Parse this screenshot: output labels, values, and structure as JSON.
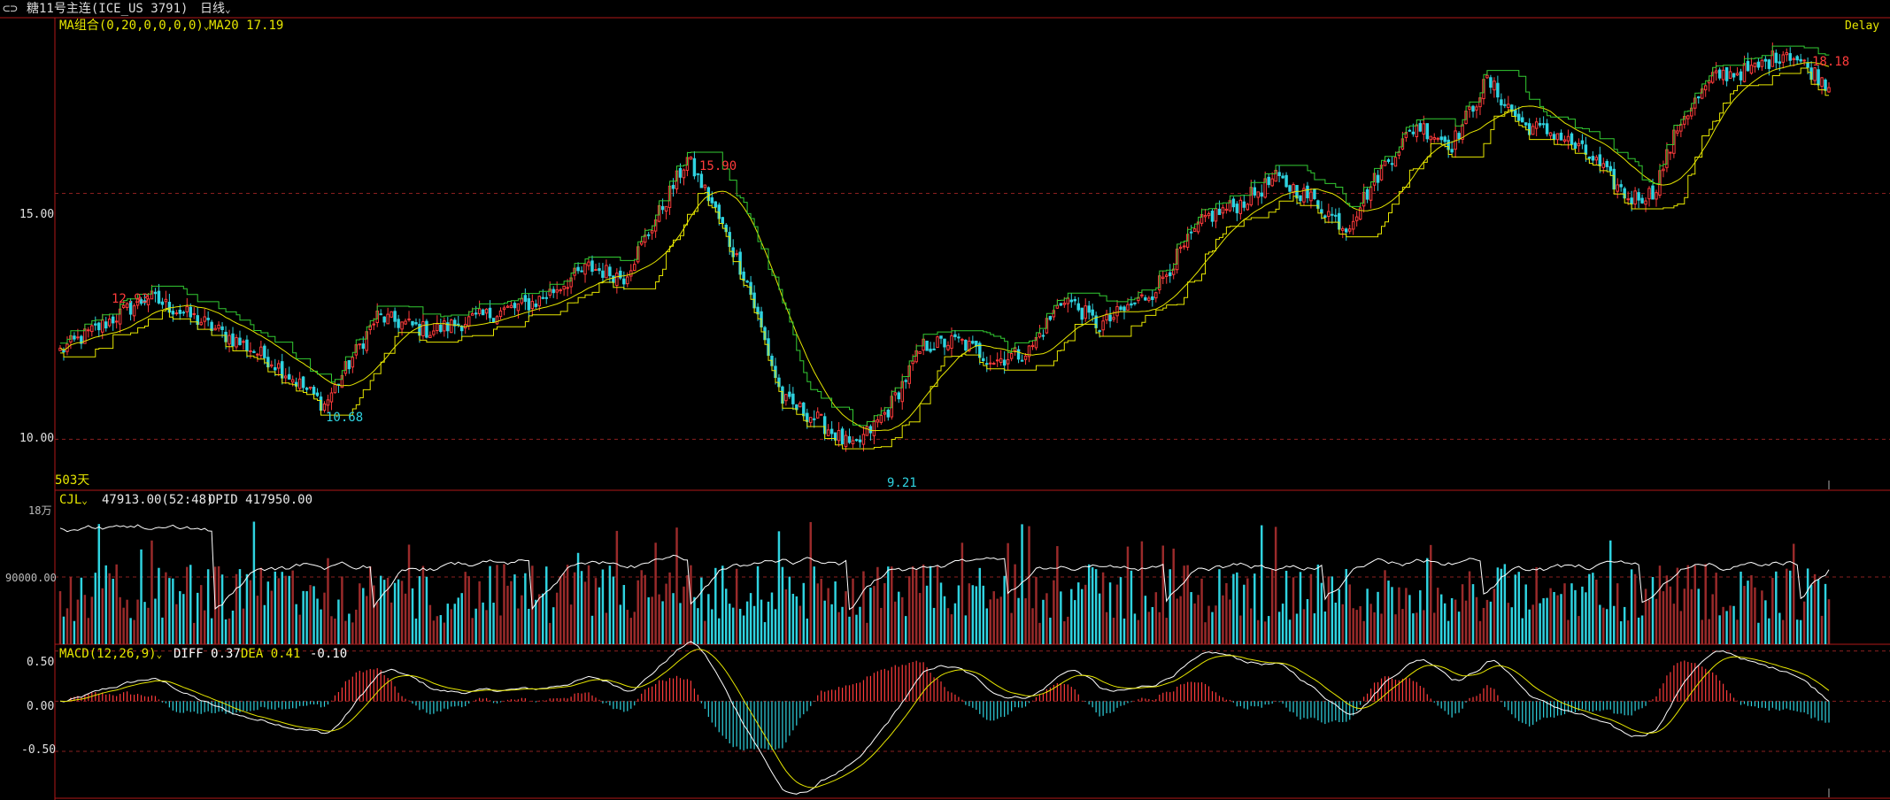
{
  "header": {
    "contract_icon": "link-icon",
    "contract": "糖11号主连(ICE_US 3791)",
    "period": "日线",
    "period_dropdown_icon": "chevron-down-icon"
  },
  "price_panel": {
    "ma_title": "MA组合(0,20,0,0,0,0)",
    "ma_dropdown_icon": "chevron-down-icon",
    "ma20_label": "MA20",
    "ma20_value": "17.19",
    "delay": "Delay",
    "y_ticks": [
      "15.00",
      "10.00"
    ],
    "high_labels": [
      "12.93",
      "15.90",
      "18.18"
    ],
    "low_labels": [
      "10.68",
      "9.21"
    ],
    "days_label": "503天"
  },
  "volume_panel": {
    "title": "CJL",
    "dropdown_icon": "chevron-down-icon",
    "volume_readout": "47913.00(52:48)",
    "opid_readout": "OPID 417950.00",
    "y_ticks": [
      "18万",
      "90000.00"
    ]
  },
  "macd_panel": {
    "title": "MACD(12,26,9)",
    "dropdown_icon": "chevron-down-icon",
    "diff_readout": "DIFF 0.37",
    "dea_readout": "DEA 0.41",
    "macd_readout": "-0.10",
    "y_ticks": [
      "0.50",
      "0.00",
      "-0.50"
    ]
  },
  "colors": {
    "up": "#ff3b3b",
    "down": "#2fd3e0",
    "ma20": "#e6e600",
    "step_green": "#33cc33",
    "step_yellow": "#e6e600",
    "vol_up": "#9a2a2a",
    "vol_down": "#2fd3e0",
    "oi_line": "#ffffff",
    "diff": "#ffffff",
    "dea": "#e6e600",
    "grid": "#8a1f1f",
    "frame": "#b01818"
  },
  "chart_data": {
    "type": "candlestick",
    "bars": 503,
    "ylim": [
      9.0,
      18.5
    ],
    "price_path_anchors": {
      "index": [
        0,
        25,
        40,
        60,
        75,
        90,
        105,
        120,
        135,
        150,
        160,
        170,
        178,
        185,
        195,
        205,
        215,
        225,
        235,
        245,
        255,
        265,
        275,
        285,
        295,
        310,
        325,
        335,
        345,
        355,
        365,
        375,
        385,
        395,
        405,
        415,
        425,
        435,
        445,
        452,
        460,
        470,
        480,
        490,
        502
      ],
      "close": [
        11.8,
        12.9,
        12.4,
        11.6,
        10.7,
        12.5,
        12.2,
        12.5,
        12.8,
        13.5,
        13.3,
        14.6,
        15.7,
        14.8,
        13.2,
        10.8,
        10.4,
        9.8,
        10.6,
        11.9,
        12.0,
        11.6,
        11.8,
        12.9,
        12.3,
        13.0,
        14.5,
        14.8,
        15.3,
        14.9,
        14.3,
        15.5,
        16.4,
        16.0,
        17.3,
        16.4,
        16.2,
        15.7,
        14.9,
        15.0,
        16.5,
        17.4,
        17.5,
        17.9,
        17.2
      ]
    },
    "extremes": [
      {
        "label": "12.93",
        "value": 12.93,
        "kind": "high"
      },
      {
        "label": "10.68",
        "value": 10.68,
        "kind": "low"
      },
      {
        "label": "15.90",
        "value": 15.9,
        "kind": "high"
      },
      {
        "label": "9.21",
        "value": 9.21,
        "kind": "low"
      },
      {
        "label": "18.18",
        "value": 18.18,
        "kind": "high"
      }
    ],
    "volume": {
      "ylim": [
        0,
        180000
      ],
      "open_interest_range": [
        300000,
        460000
      ]
    },
    "macd": {
      "ylim": [
        -0.95,
        0.55
      ]
    }
  }
}
